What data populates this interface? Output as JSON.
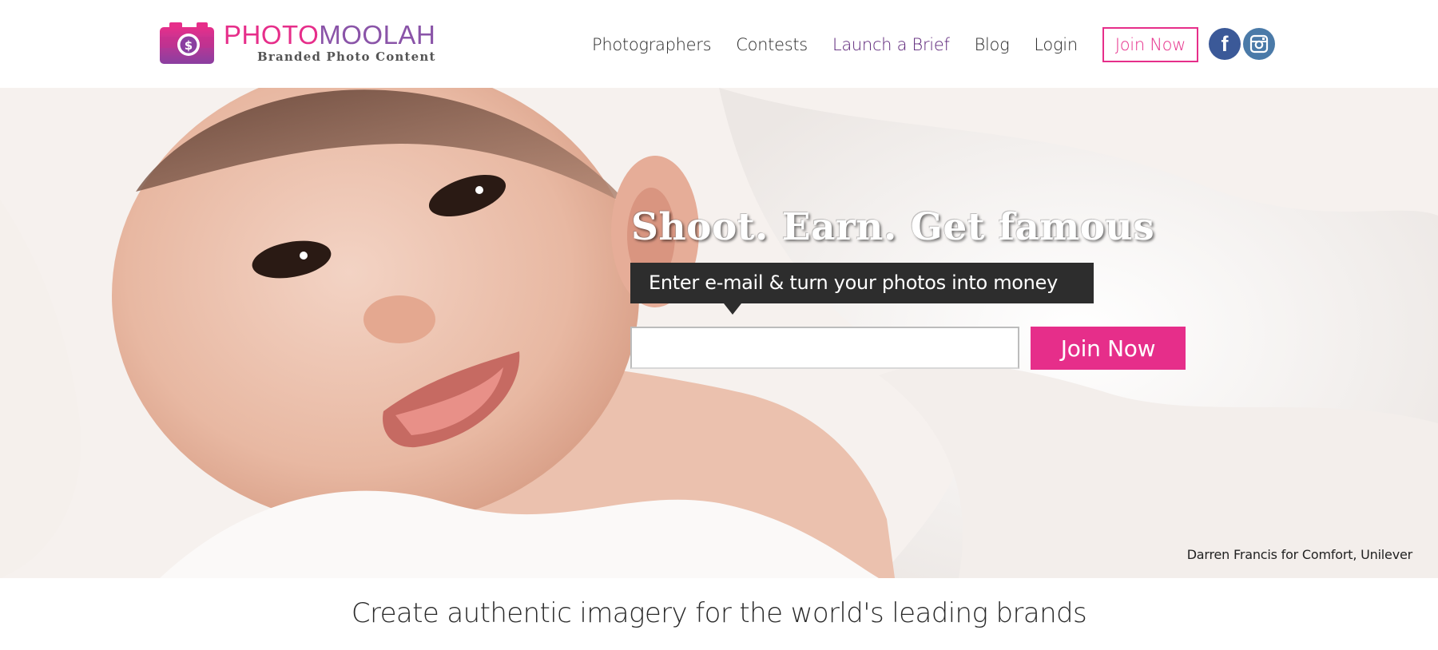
{
  "brand": {
    "word_part1": "PHOTO",
    "word_part2": "MOOLAH",
    "tagline": "Branded Photo Content",
    "colors": {
      "pink": "#e62e8a",
      "purple": "#8a54a8",
      "nav_active": "#5b2378"
    },
    "logo_icon": "camera-dollar-icon"
  },
  "nav": {
    "photographers": "Photographers",
    "contests": "Contests",
    "launch_brief": "Launch a Brief",
    "blog": "Blog",
    "login": "Login",
    "join": "Join Now"
  },
  "social": {
    "facebook_glyph": "f",
    "facebook_icon": "facebook-icon",
    "instagram_icon": "instagram-icon"
  },
  "hero": {
    "headline": "Shoot. Earn. Get famous",
    "prompt": "Enter e-mail & turn your photos into money",
    "email_value": "",
    "button": "Join Now",
    "credit": "Darren Francis for Comfort, Unilever"
  },
  "tagline": "Create authentic imagery for the world's leading brands"
}
